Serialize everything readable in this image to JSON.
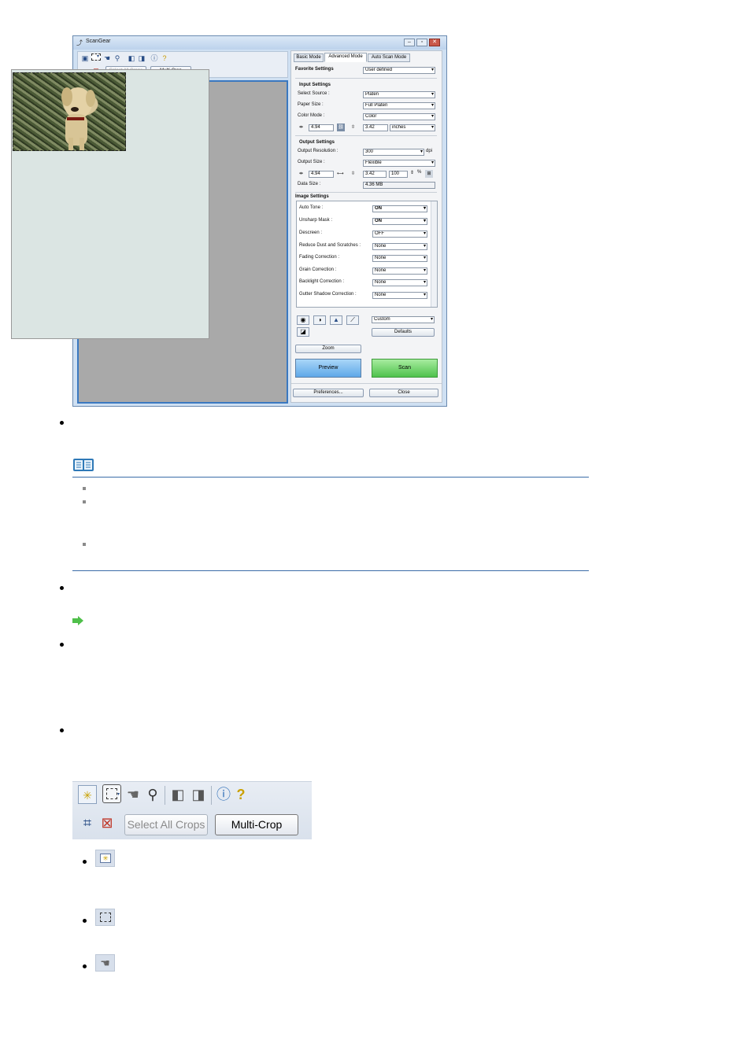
{
  "window": {
    "title": "ScanGear",
    "toolbar": {
      "select_all_crops": "Select All Crops",
      "multi_crop": "Multi-Crop"
    },
    "tabs": [
      "Basic Mode",
      "Advanced Mode",
      "Auto Scan Mode"
    ],
    "favorite_settings": {
      "label": "Favorite Settings",
      "value": "User defined"
    },
    "input_settings": {
      "heading": "Input Settings",
      "select_source": {
        "label": "Select Source :",
        "value": "Platen"
      },
      "paper_size": {
        "label": "Paper Size :",
        "value": "Full Platen"
      },
      "color_mode": {
        "label": "Color Mode :",
        "value": "Color"
      },
      "width": "4.94",
      "height": "3.42",
      "unit": "inches"
    },
    "output_settings": {
      "heading": "Output Settings",
      "resolution": {
        "label": "Output Resolution :",
        "value": "300",
        "unit": "dpi"
      },
      "output_size": {
        "label": "Output Size :",
        "value": "Flexible"
      },
      "width": "4.94",
      "height": "3.42",
      "scale": "100",
      "percent": "%",
      "data_size": {
        "label": "Data Size :",
        "value": "4.36 MB"
      }
    },
    "image_settings": {
      "heading": "Image Settings",
      "rows": [
        {
          "label": "Auto Tone :",
          "value": "ON"
        },
        {
          "label": "Unsharp Mask :",
          "value": "ON"
        },
        {
          "label": "Descreen :",
          "value": "OFF"
        },
        {
          "label": "Reduce Dust and Scratches :",
          "value": "None"
        },
        {
          "label": "Fading Correction :",
          "value": "None"
        },
        {
          "label": "Grain Correction :",
          "value": "None"
        },
        {
          "label": "Backlight Correction :",
          "value": "None"
        },
        {
          "label": "Gutter Shadow Correction :",
          "value": "None"
        }
      ]
    },
    "color_adjust": {
      "value": "Custom",
      "defaults": "Defaults"
    },
    "zoom": "Zoom",
    "preview": "Preview",
    "scan": "Scan",
    "preferences": "Preferences...",
    "close": "Close"
  },
  "big_toolbar": {
    "select_all_crops": "Select All Crops",
    "multi_crop": "Multi-Crop"
  },
  "colors": {
    "accent_rule": "#3b6ca8",
    "preview_button": "#6fb3ee",
    "scan_button": "#6cd36a"
  }
}
